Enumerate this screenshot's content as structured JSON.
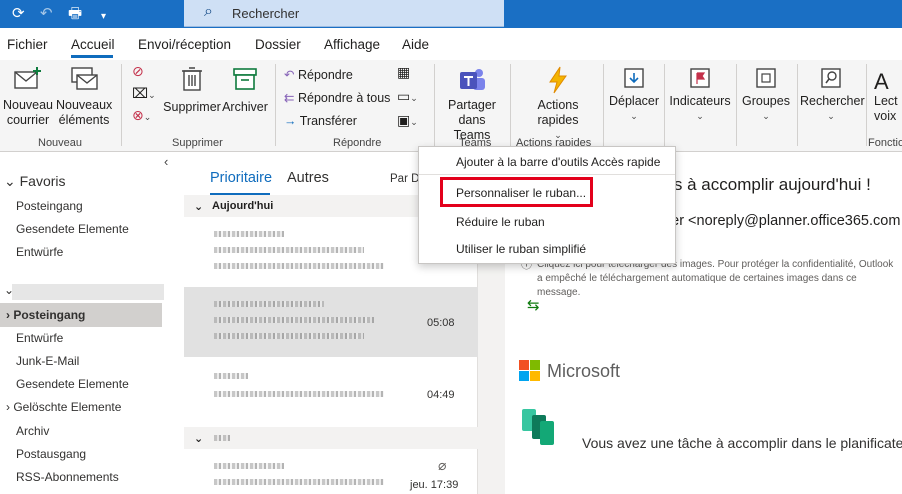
{
  "titlebar": {
    "search_placeholder": "Rechercher"
  },
  "menu_tabs": [
    "Fichier",
    "Accueil",
    "Envoi/réception",
    "Dossier",
    "Affichage",
    "Aide"
  ],
  "ribbon": {
    "nouveau_courrier": "Nouveau courrier",
    "nouveaux_elements": "Nouveaux éléments",
    "supprimer": "Supprimer",
    "archiver": "Archiver",
    "repondre": "Répondre",
    "repondre_tous": "Répondre à tous",
    "transferer": "Transférer",
    "partager_teams": "Partager dans Teams",
    "actions_rapides": "Actions rapides",
    "deplacer": "Déplacer",
    "indicateurs": "Indicateurs",
    "groupes": "Groupes",
    "rechercher": "Rechercher",
    "lecture_partial": "Lect voix",
    "groups": {
      "nouveau": "Nouveau",
      "supprimer": "Supprimer",
      "repondre": "Répondre",
      "teams": "Teams",
      "actions_rapides": "Actions rapides",
      "fonctions_partial": "Fonctio"
    }
  },
  "left_pane": {
    "favorites_header": "Favoris",
    "favorites": [
      "Posteingang",
      "Gesendete Elemente",
      "Entwürfe"
    ],
    "folders": [
      "Posteingang",
      "Entwürfe",
      "Junk-E-Mail",
      "Gesendete Elemente",
      "Gelöschte Elemente",
      "Archiv",
      "Postausgang",
      "RSS-Abonnements"
    ]
  },
  "message_list": {
    "tab_focused": "Prioritaire",
    "tab_other": "Autres",
    "sort_partial": "Par D",
    "group_today": "Aujourd'hui",
    "times": [
      "05:08",
      "04:49",
      "jeu. 17:39"
    ]
  },
  "reading_pane": {
    "title_partial": "nes à accomplir aujourd'hui !",
    "from_partial": "nner <noreply@planner.office365.com",
    "to_partial": "ier",
    "info_text": "Cliquez ici pour télécharger des images. Pour protéger la confidentialité, Outlook a empêché le téléchargement automatique de certaines images dans ce message.",
    "brand": "Microsoft",
    "body_text": "Vous avez une tâche à accomplir dans le planificateur"
  },
  "context_menu": {
    "items": [
      "Ajouter à la barre d'outils Accès rapide",
      "Personnaliser le ruban...",
      "Réduire le ruban",
      "Utiliser le ruban simplifié"
    ]
  },
  "colors": {
    "titlebar": "#1a6fc4",
    "accent": "#0f6cbd",
    "highlight": "#e3001b"
  }
}
